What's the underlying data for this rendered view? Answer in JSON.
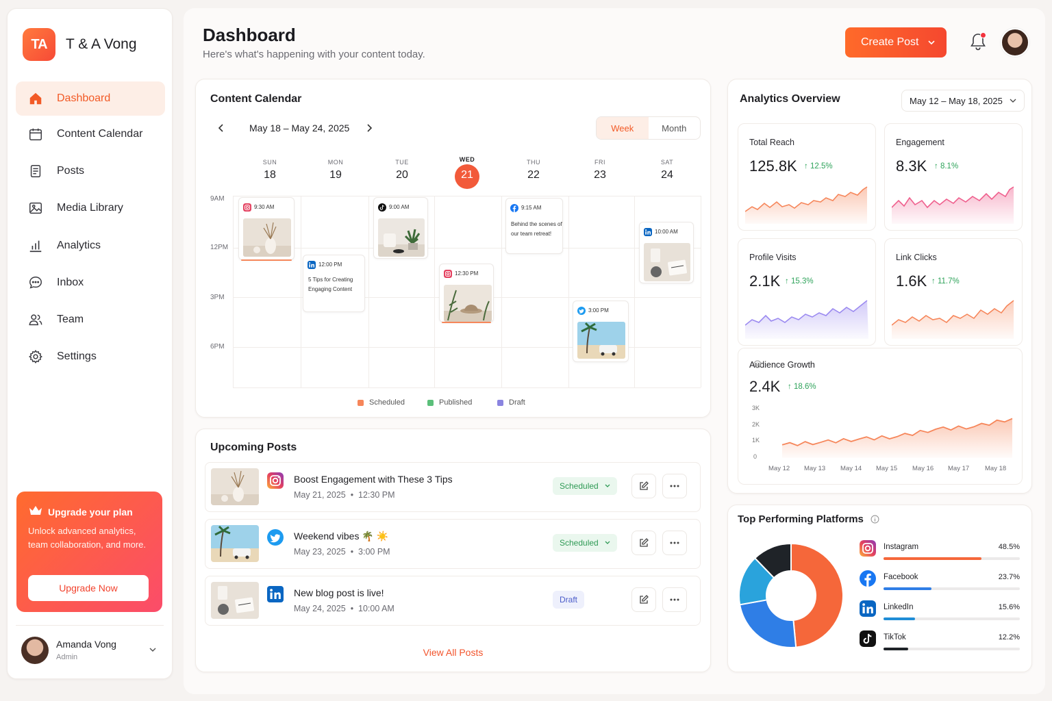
{
  "brand": {
    "logo_text": "TA",
    "name": "T & A Vong"
  },
  "nav": [
    {
      "label": "Dashboard",
      "icon": "home-icon"
    },
    {
      "label": "Content Calendar",
      "icon": "calendar-icon"
    },
    {
      "label": "Posts",
      "icon": "document-icon"
    },
    {
      "label": "Media Library",
      "icon": "image-icon"
    },
    {
      "label": "Analytics",
      "icon": "bar-chart-icon"
    },
    {
      "label": "Inbox",
      "icon": "chat-bubble-icon"
    },
    {
      "label": "Team",
      "icon": "users-icon"
    },
    {
      "label": "Settings",
      "icon": "gear-icon"
    }
  ],
  "upgrade": {
    "title": "Upgrade your plan",
    "description": "Unlock advanced analytics, team collaboration, and more.",
    "button": "Upgrade Now"
  },
  "user": {
    "name": "Amanda Vong",
    "role": "Admin"
  },
  "header": {
    "title": "Dashboard",
    "subtitle": "Here's what's happening with your content today.",
    "create_button": "Create Post"
  },
  "calendar": {
    "title": "Content Calendar",
    "range": "May 18 – May 24, 2025",
    "view_week": "Week",
    "view_month": "Month",
    "days": [
      {
        "name": "SUN",
        "date": "18"
      },
      {
        "name": "MON",
        "date": "19"
      },
      {
        "name": "TUE",
        "date": "20"
      },
      {
        "name": "WED",
        "date": "21"
      },
      {
        "name": "THU",
        "date": "22"
      },
      {
        "name": "FRI",
        "date": "23"
      },
      {
        "name": "SAT",
        "date": "24"
      }
    ],
    "times": [
      "9AM",
      "12PM",
      "3PM",
      "6PM"
    ],
    "posts": [
      {
        "time": "9:30 AM",
        "platform": "instagram"
      },
      {
        "time": "12:00 PM",
        "platform": "linkedin",
        "text": "5 Tips for Creating Engaging Content"
      },
      {
        "time": "9:00 AM",
        "platform": "tiktok"
      },
      {
        "time": "12:30 PM",
        "platform": "instagram"
      },
      {
        "time": "9:15 AM",
        "platform": "facebook",
        "text": "Behind the scenes of our team retreat!"
      },
      {
        "time": "3:00 PM",
        "platform": "twitter"
      },
      {
        "time": "10:00 AM",
        "platform": "linkedin"
      }
    ],
    "legend": [
      "Scheduled",
      "Published",
      "Draft"
    ],
    "colors": {
      "scheduled": "#f6865a",
      "published": "#5bbf7a",
      "draft": "#8a84e0"
    }
  },
  "upcoming": {
    "title": "Upcoming Posts",
    "posts": [
      {
        "title": "Boost Engagement with These 3 Tips",
        "date": "May 21, 2025",
        "time": "12:30 PM",
        "status": "Scheduled",
        "platform": "instagram"
      },
      {
        "title": "Weekend vibes 🌴 ☀️",
        "date": "May 23, 2025",
        "time": "3:00 PM",
        "status": "Scheduled",
        "platform": "twitter"
      },
      {
        "title": "New blog post is live!",
        "date": "May 24, 2025",
        "time": "10:00 AM",
        "status": "Draft",
        "platform": "linkedin"
      }
    ],
    "view_all": "View All Posts"
  },
  "analytics": {
    "title": "Analytics Overview",
    "range": "May 12 – May 18, 2025",
    "metrics": [
      {
        "label": "Total Reach",
        "value": "125.8K",
        "change": "12.5%",
        "color": "#f6865a"
      },
      {
        "label": "Engagement",
        "value": "8.3K",
        "change": "8.1%",
        "color": "#ef5f8d"
      },
      {
        "label": "Profile Visits",
        "value": "2.1K",
        "change": "15.3%",
        "color": "#9b8af0"
      },
      {
        "label": "Link Clicks",
        "value": "1.6K",
        "change": "11.7%",
        "color": "#f6865a"
      }
    ],
    "growth": {
      "label": "Audience Growth",
      "value": "2.4K",
      "change": "18.6%"
    }
  },
  "chart_data": {
    "type": "area",
    "x": [
      "May 12",
      "May 13",
      "May 14",
      "May 15",
      "May 16",
      "May 17",
      "May 18"
    ],
    "y_ticks": [
      "3K",
      "2K",
      "1K",
      "0"
    ],
    "ylim": [
      0,
      3000
    ],
    "values": [
      800,
      950,
      1150,
      1300,
      1750,
      1900,
      2400
    ]
  },
  "platforms": {
    "title": "Top Performing Platforms",
    "items": [
      {
        "name": "Instagram",
        "percent": "48.5%",
        "value": 48.5,
        "color": "#f5673a"
      },
      {
        "name": "Facebook",
        "percent": "23.7%",
        "value": 23.7,
        "color": "#2f7ee6"
      },
      {
        "name": "LinkedIn",
        "percent": "15.6%",
        "value": 15.6,
        "color": "#1f8dd6"
      },
      {
        "name": "TikTok",
        "percent": "12.2%",
        "value": 12.2,
        "color": "#1f2328"
      }
    ]
  }
}
